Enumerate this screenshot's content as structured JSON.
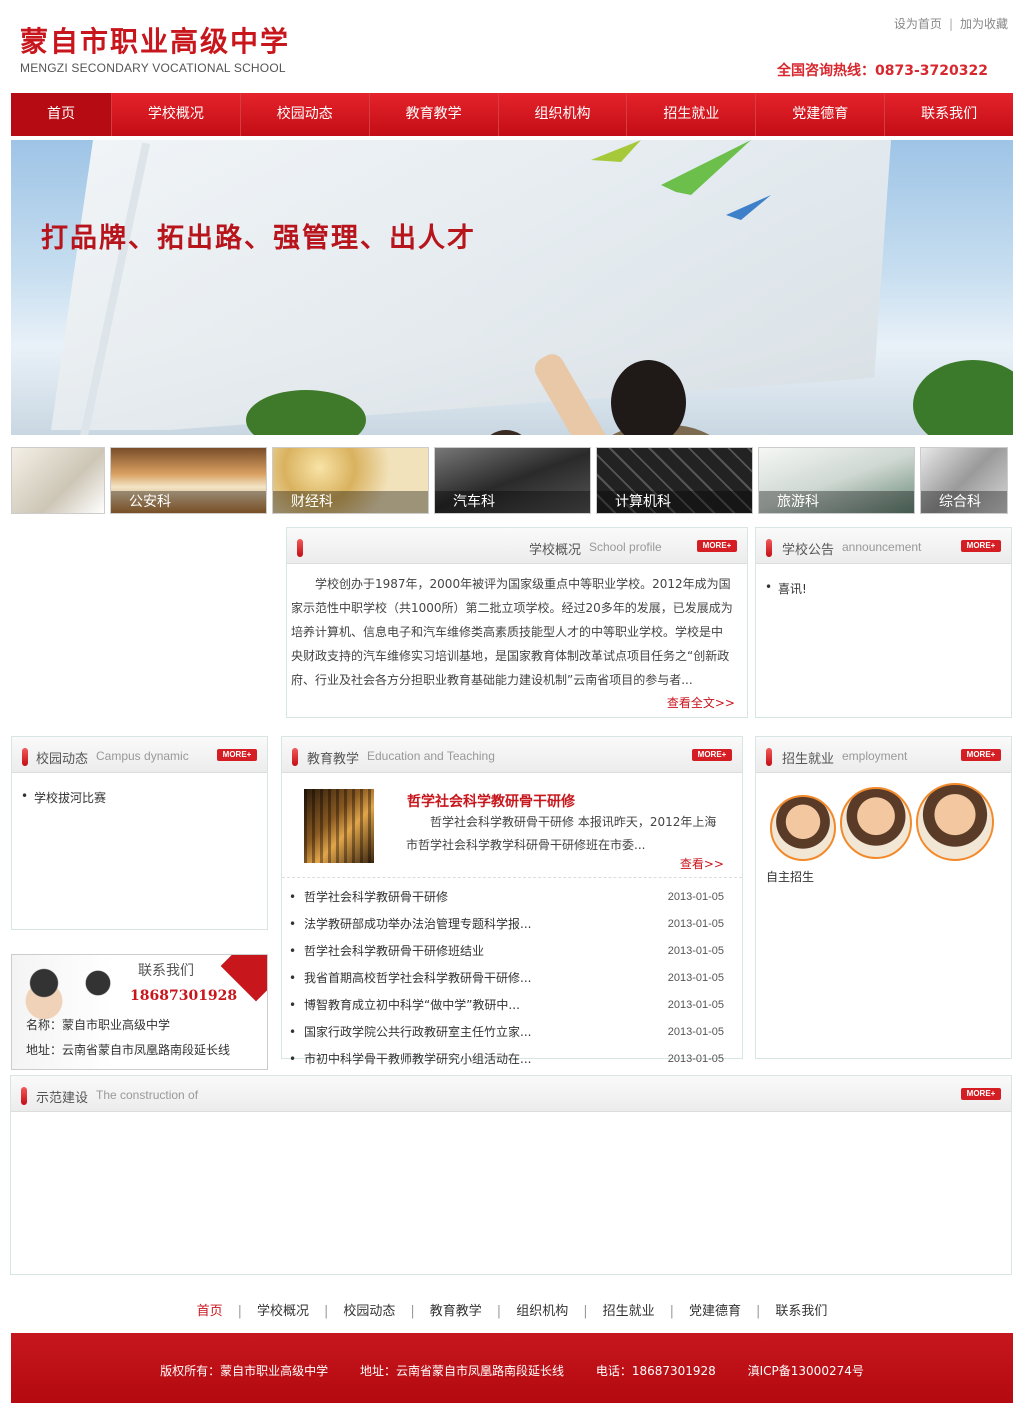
{
  "header": {
    "logo_cn": "蒙自市职业高级中学",
    "logo_en": "MENGZI SECONDARY VOCATIONAL SCHOOL",
    "set_home": "设为首页",
    "separator": "|",
    "add_fav": "加为收藏",
    "hotline": "全国咨询热线：0873-3720322"
  },
  "nav": {
    "items": [
      "首页",
      "学校概况",
      "校园动态",
      "教育教学",
      "组织机构",
      "招生就业",
      "党建德育",
      "联系我们"
    ]
  },
  "banner": {
    "slogan": "打品牌、拓出路、强管理、出人才"
  },
  "departments": [
    {
      "label": ""
    },
    {
      "label": "公安科"
    },
    {
      "label": "财经科"
    },
    {
      "label": "汽车科"
    },
    {
      "label": "计算机科"
    },
    {
      "label": "旅游科"
    },
    {
      "label": "综合科"
    }
  ],
  "profile": {
    "title_cn": "学校概况",
    "title_en": "School profile",
    "more_badge": "MORE+",
    "text": "学校创办于1987年，2000年被评为国家级重点中等职业学校。2012年成为国家示范性中职学校（共1000所）第二批立项学校。经过20多年的发展，已发展成为培养计算机、信息电子和汽车维修类高素质技能型人才的中等职业学校。学校是中央财政支持的汽车维修实习培训基地，是国家教育体制改革试点项目任务之“创新政府、行业及社会各方分担职业教育基础能力建设机制”云南省项目的参与者...",
    "read_more": "查看全文>>"
  },
  "announcement": {
    "title_cn": "学校公告",
    "title_en": "announcement",
    "more_badge": "MORE+",
    "items": [
      "喜讯!"
    ]
  },
  "campus": {
    "title_cn": "校园动态",
    "title_en": "Campus dynamic",
    "more_badge": "MORE+",
    "items": [
      "学校拔河比赛"
    ]
  },
  "education": {
    "title_cn": "教育教学",
    "title_en": "Education and Teaching",
    "more_badge": "MORE+",
    "feature_title": "哲学社会科学教研骨干研修",
    "feature_desc": "哲学社会科学教研骨干研修 本报讯昨天，2012年上海市哲学社会科学教学科研骨干研修班在市委...",
    "feature_more": "查看>>",
    "list": [
      {
        "title": "哲学社会科学教研骨干研修",
        "date": "2013-01-05"
      },
      {
        "title": "法学教研部成功举办法治管理专题科学报...",
        "date": "2013-01-05"
      },
      {
        "title": "哲学社会科学教研骨干研修班结业",
        "date": "2013-01-05"
      },
      {
        "title": "我省首期高校哲学社会科学教研骨干研修...",
        "date": "2013-01-05"
      },
      {
        "title": "博智教育成立初中科学“做中学”教研中...",
        "date": "2013-01-05"
      },
      {
        "title": "国家行政学院公共行政教研室主任竹立家...",
        "date": "2013-01-05"
      },
      {
        "title": "市初中科学骨干教师教学研究小组活动在...",
        "date": "2013-01-05"
      }
    ]
  },
  "employment": {
    "title_cn": "招生就业",
    "title_en": "employment",
    "more_badge": "MORE+",
    "caption": "自主招生"
  },
  "contact": {
    "title": "联系我们",
    "phone": "18687301928",
    "name": "名称：蒙自市职业高级中学",
    "address": "地址：云南省蒙自市凤凰路南段延长线"
  },
  "demo": {
    "title_cn": "示范建设",
    "title_en": "The construction of",
    "more_badge": "MORE+"
  },
  "footer_nav": {
    "items": [
      "首页",
      "学校概况",
      "校园动态",
      "教育教学",
      "组织机构",
      "招生就业",
      "党建德育",
      "联系我们"
    ],
    "separator": "|"
  },
  "footer": {
    "copyright": "版权所有：蒙自市职业高级中学",
    "address": "地址：云南省蒙自市凤凰路南段延长线",
    "phone": "电话：18687301928",
    "icp": "滇ICP备13000274号"
  },
  "colors": {
    "brand_red": "#c8161d",
    "nav_red": "#d51e24"
  }
}
